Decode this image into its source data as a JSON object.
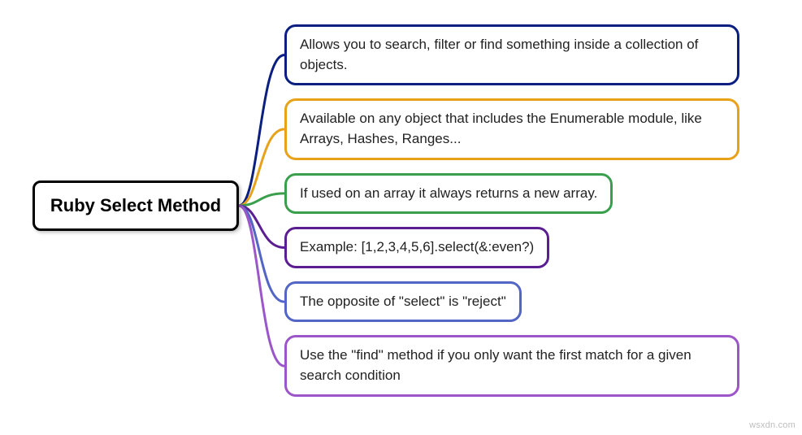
{
  "root": {
    "label": "Ruby Select Method"
  },
  "branches": [
    {
      "text": "Allows you to search, filter or find something inside a collection of objects.",
      "color": "#0b1f80"
    },
    {
      "text": "Available on any object that includes the Enumerable module, like Arrays, Hashes, Ranges...",
      "color": "#e8a21a"
    },
    {
      "text": "If used on an array it always returns a new array.",
      "color": "#3a9f4d"
    },
    {
      "text": "Example: [1,2,3,4,5,6].select(&:even?)",
      "color": "#5b1e91"
    },
    {
      "text": "The opposite of \"select\" is \"reject\"",
      "color": "#5365c5"
    },
    {
      "text": "Use the \"find\" method if you only want the first match for a given search condition",
      "color": "#9b56c9"
    }
  ],
  "watermark": "wsxdn.com"
}
